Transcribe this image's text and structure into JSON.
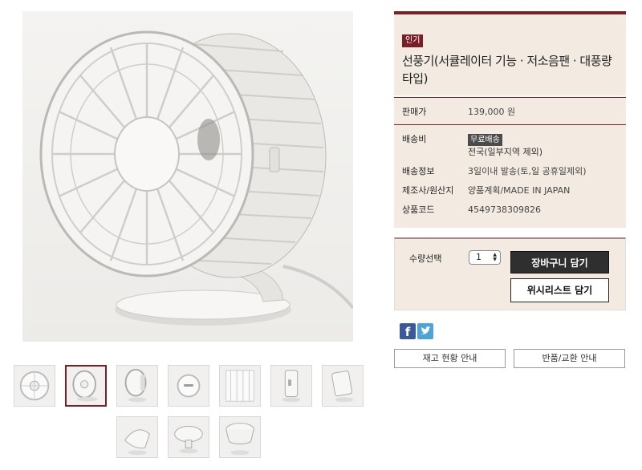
{
  "product": {
    "badge": "인기",
    "title": "선풍기(서큘레이터 기능 · 저소음팬 · 대풍량타입)"
  },
  "price": {
    "label": "판매가",
    "value": "139,000 원"
  },
  "details": [
    {
      "label": "배송비",
      "badge": "무료배송",
      "value": "전국(일부지역 제외)"
    },
    {
      "label": "배송정보",
      "value": "3일이내 발송(토,일 공휴일제외)"
    },
    {
      "label": "제조사/원산지",
      "value": "양품계획/MADE IN JAPAN"
    },
    {
      "label": "상품코드",
      "value": "4549738309826"
    }
  ],
  "order": {
    "qty_label": "수량선택",
    "qty_value": "1",
    "cart_button": "장바구니 담기",
    "wish_button": "위시리스트 담기"
  },
  "social": {
    "facebook": "facebook-icon",
    "twitter": "twitter-icon"
  },
  "actions": {
    "stock": "재고 현황 안내",
    "return": "반품/교환 안내"
  },
  "colors": {
    "accent": "#7a1f26",
    "panel": "#f3ebe2"
  }
}
